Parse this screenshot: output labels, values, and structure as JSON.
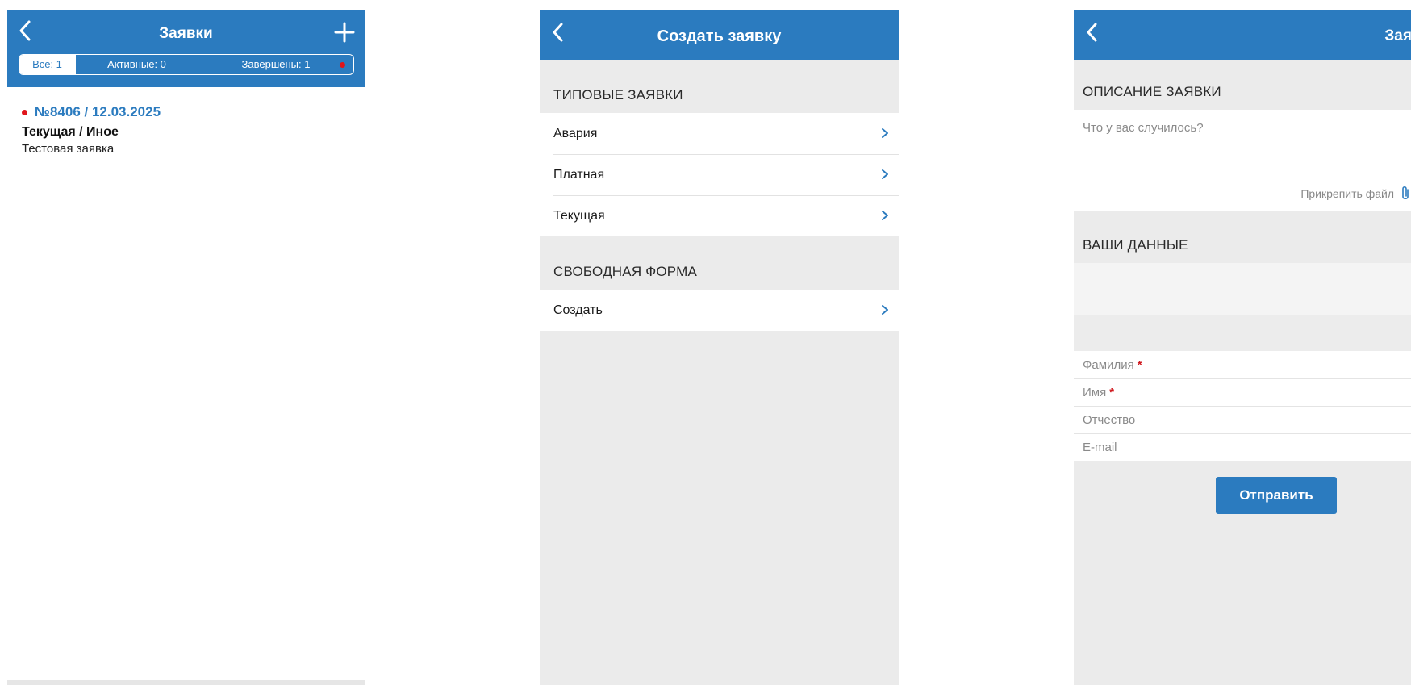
{
  "screen_list": {
    "title": "Заявки",
    "tabs": [
      {
        "label": "Все: 1"
      },
      {
        "label": "Активные: 0"
      },
      {
        "label": "Завершены: 1"
      }
    ],
    "request": {
      "number_date": "№8406 / 12.03.2025",
      "type": "Текущая / Иное",
      "description": "Тестовая заявка"
    }
  },
  "screen_create": {
    "title": "Создать заявку",
    "typical_header": "ТИПОВЫЕ ЗАЯВКИ",
    "typical_items": [
      {
        "label": "Авария"
      },
      {
        "label": "Платная"
      },
      {
        "label": "Текущая"
      }
    ],
    "free_header": "СВОБОДНАЯ ФОРМА",
    "free_items": [
      {
        "label": "Создать"
      }
    ]
  },
  "screen_form": {
    "title": "Заявка",
    "description_header": "ОПИСАНИЕ ЗАЯВКИ",
    "description_placeholder": "Что у вас случилось?",
    "attach_label": "Прикрепить файл",
    "data_header": "ВАШИ ДАННЫЕ",
    "fields": [
      {
        "label": "Фамилия",
        "required": "*"
      },
      {
        "label": "Имя",
        "required": "*"
      },
      {
        "label": "Отчество"
      },
      {
        "label": "E-mail"
      }
    ],
    "submit_label": "Отправить"
  },
  "colors": {
    "brand": "#2b7bbf",
    "alert": "#e0151b",
    "background": "#ebebeb"
  }
}
